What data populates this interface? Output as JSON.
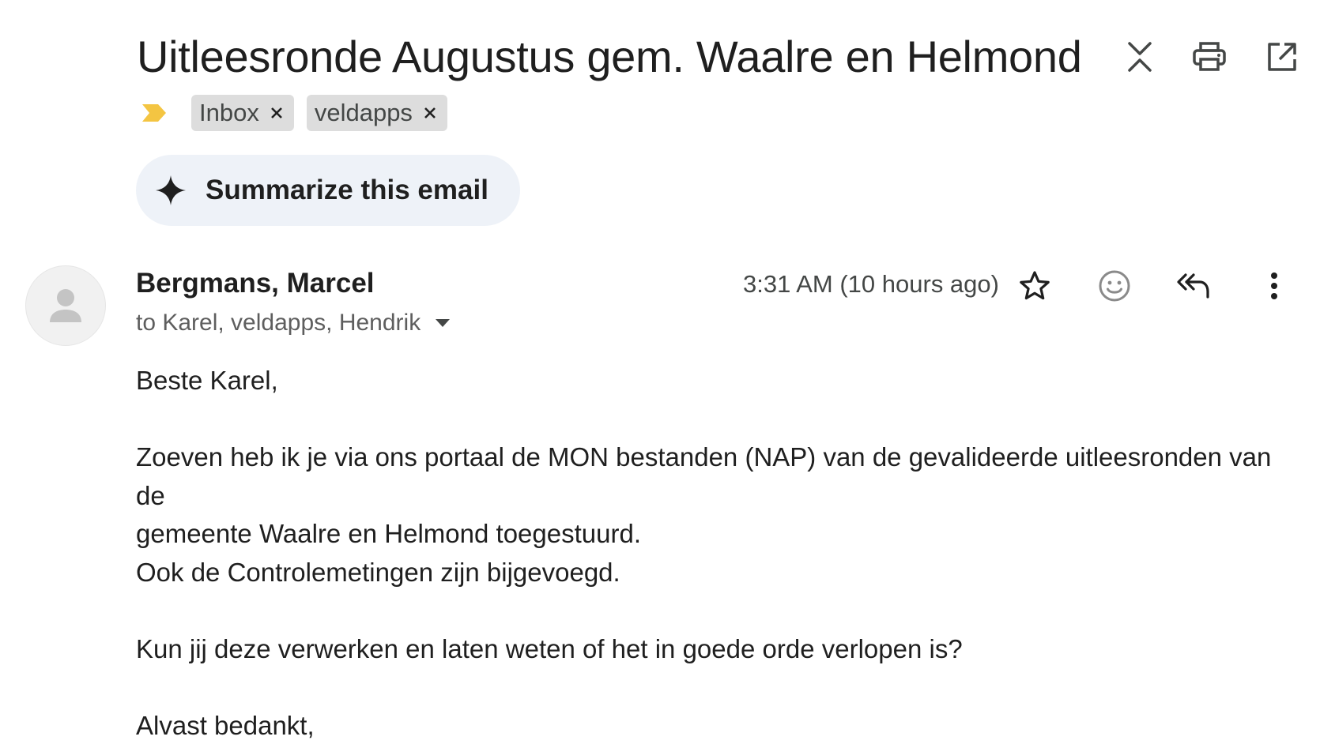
{
  "email": {
    "subject": "Uitleesronde Augustus gem. Waalre en Helmond",
    "labels": [
      {
        "name": "Inbox"
      },
      {
        "name": "veldapps"
      }
    ],
    "header_icons": [
      "collapse-all-icon",
      "print-icon",
      "open-in-new-window-icon"
    ],
    "important_marker_color": "#f4c542",
    "summarize_label": "Summarize this email",
    "sender": {
      "name": "Bergmans, Marcel",
      "recipients": "to Karel, veldapps, Hendrik"
    },
    "timestamp": "3:31 AM (10 hours ago)",
    "message_icons": [
      "star-icon",
      "emoji-reaction-icon",
      "reply-all-icon",
      "more-options-icon"
    ],
    "body": {
      "greeting": "Beste Karel,",
      "paragraph1_line1": "Zoeven heb ik je via ons portaal de MON bestanden (NAP) van de gevalideerde uitleesronden van de",
      "paragraph1_line2": "gemeente Waalre en Helmond toegestuurd.",
      "paragraph1_line3": "Ook de Controlemetingen zijn bijgevoegd.",
      "paragraph2": "Kun jij deze verwerken en laten weten of het in goede orde verlopen is?",
      "closing": "Alvast bedankt,"
    }
  }
}
